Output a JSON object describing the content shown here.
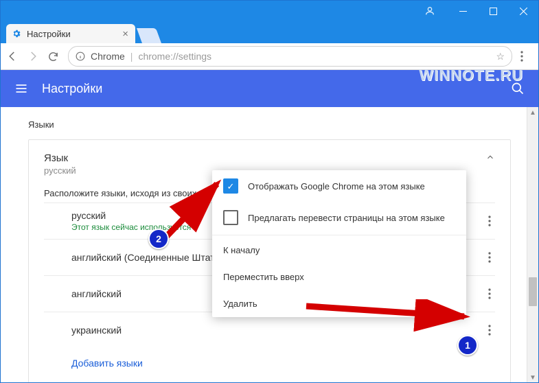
{
  "window": {
    "tab_title": "Настройки"
  },
  "omnibox": {
    "product": "Chrome",
    "url_path": "chrome://settings"
  },
  "header": {
    "title": "Настройки"
  },
  "section": {
    "title": "Языки"
  },
  "card": {
    "title": "Язык",
    "subtitle": "русский",
    "hint": "Расположите языки, исходя из своих предпочтений"
  },
  "languages": [
    {
      "name": "русский",
      "sub": "Этот язык сейчас используется"
    },
    {
      "name": "английский (Соединенные Штаты)",
      "sub": ""
    },
    {
      "name": "английский",
      "sub": ""
    },
    {
      "name": "украинский",
      "sub": ""
    }
  ],
  "add_languages": "Добавить языки",
  "popup": {
    "display_chrome": "Отображать Google Chrome на этом языке",
    "offer_translate": "Предлагать перевести страницы на этом языке",
    "to_top": "К началу",
    "move_up": "Переместить вверх",
    "remove": "Удалить"
  },
  "annotations": {
    "badge1": "1",
    "badge2": "2"
  },
  "watermark": "WINNOTE.RU"
}
